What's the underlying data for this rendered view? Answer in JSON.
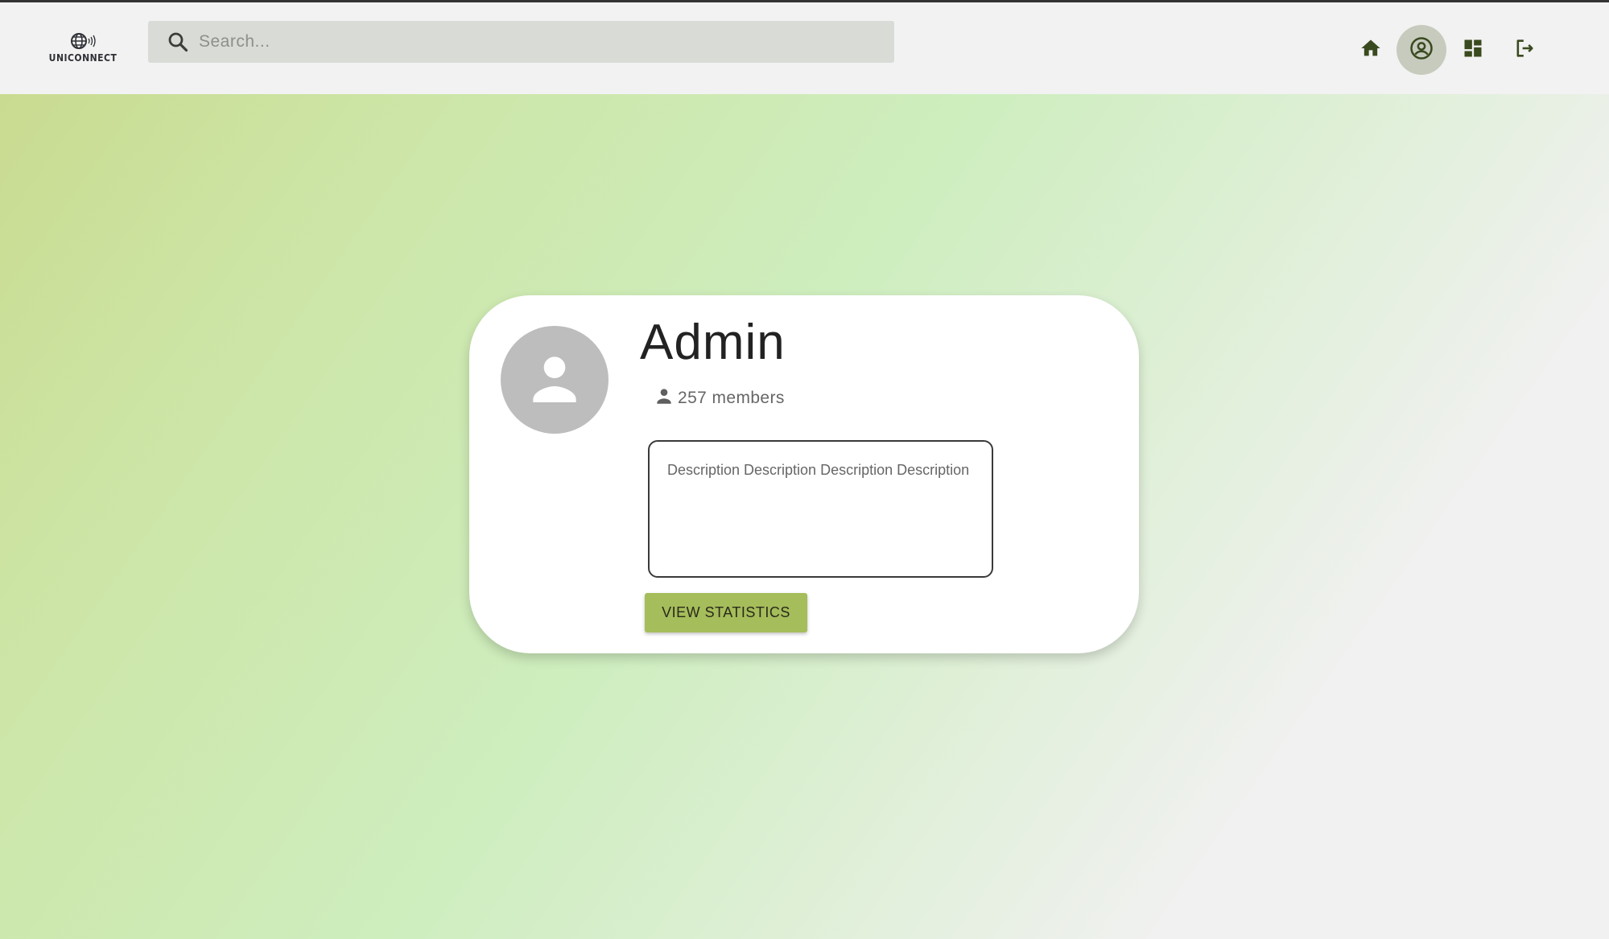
{
  "header": {
    "logo_text": "UNICONNECT",
    "search": {
      "placeholder": "Search...",
      "value": ""
    },
    "nav": {
      "home_icon": "home-icon",
      "profile_icon": "account-circle-icon",
      "dashboard_icon": "dashboard-icon",
      "logout_icon": "logout-icon",
      "active": "profile"
    }
  },
  "profile": {
    "name": "Admin",
    "members_count": "257 members",
    "description": "Description Description Description Description",
    "view_statistics_label": "VIEW STATISTICS"
  },
  "colors": {
    "header_bg": "#f2f2f2",
    "search_bg": "#d9dbd6",
    "icon_color": "#3a4a1f",
    "active_nav_bg": "#c6cbbe",
    "button_bg": "#a5bd5b",
    "avatar_bg": "#bdbdbd",
    "gradient_start": "#c9db90",
    "gradient_mid": "#ceeebf",
    "gradient_end": "#f1f1f1"
  }
}
